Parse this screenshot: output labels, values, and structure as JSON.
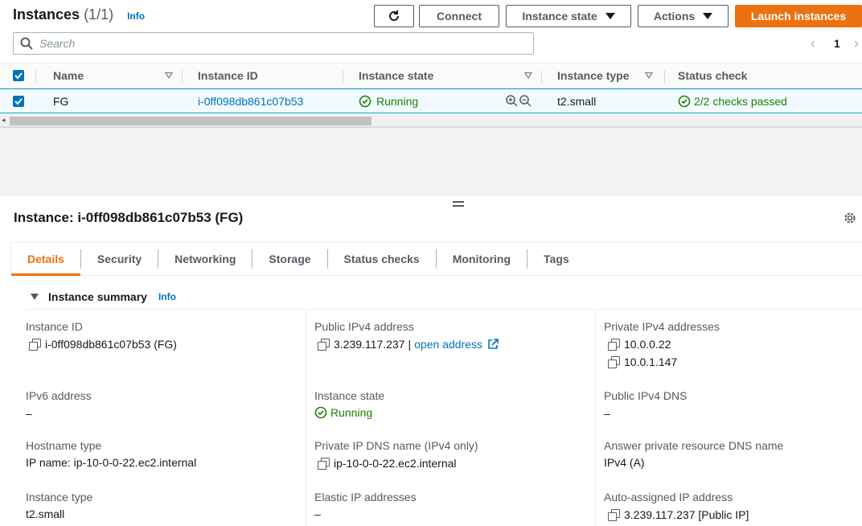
{
  "header": {
    "title": "Instances",
    "count": "(1/1)",
    "info": "Info",
    "connect": "Connect",
    "instance_state": "Instance state",
    "actions": "Actions",
    "launch": "Launch instances"
  },
  "search": {
    "placeholder": "Search"
  },
  "pagination": {
    "page": "1"
  },
  "table": {
    "columns": [
      "Name",
      "Instance ID",
      "Instance state",
      "Instance type",
      "Status check"
    ],
    "rows": [
      {
        "name": "FG",
        "id": "i-0ff098db861c07b53",
        "state": "Running",
        "type": "t2.small",
        "status": "2/2 checks passed"
      }
    ]
  },
  "details": {
    "title": "Instance: i-0ff098db861c07b53 (FG)",
    "tabs": [
      "Details",
      "Security",
      "Networking",
      "Storage",
      "Status checks",
      "Monitoring",
      "Tags"
    ],
    "summary_label": "Instance summary",
    "summary_info": "Info",
    "fields": {
      "instance_id_label": "Instance ID",
      "instance_id_value": "i-0ff098db861c07b53 (FG)",
      "public_ipv4_label": "Public IPv4 address",
      "public_ipv4_value": "3.239.117.237",
      "public_ipv4_sep": "|",
      "open_address": "open address",
      "private_ipv4_label": "Private IPv4 addresses",
      "private_ipv4_1": "10.0.0.22",
      "private_ipv4_2": "10.0.1.147",
      "ipv6_label": "IPv6 address",
      "ipv6_value": "–",
      "instance_state_label": "Instance state",
      "instance_state_value": "Running",
      "public_dns_label": "Public IPv4 DNS",
      "public_dns_value": "–",
      "hostname_type_label": "Hostname type",
      "hostname_type_value": "IP name: ip-10-0-0-22.ec2.internal",
      "private_dns_label": "Private IP DNS name (IPv4 only)",
      "private_dns_value": "ip-10-0-0-22.ec2.internal",
      "answer_dns_label": "Answer private resource DNS name",
      "answer_dns_value": "IPv4 (A)",
      "instance_type_label": "Instance type",
      "instance_type_value": "t2.small",
      "elastic_ip_label": "Elastic IP addresses",
      "elastic_ip_value": "–",
      "auto_ip_label": "Auto-assigned IP address",
      "auto_ip_value": "3.239.117.237 [Public IP]"
    }
  },
  "colors": {
    "accent": "#ec7211",
    "link": "#0073bb",
    "success": "#1d8102"
  }
}
